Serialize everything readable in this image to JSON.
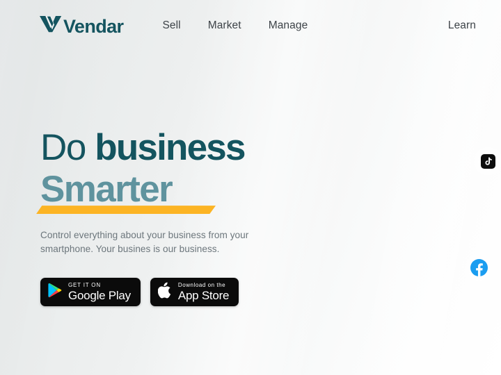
{
  "brand": {
    "name": "Vendar",
    "logo_icon": "vendar-chevron-logo-icon",
    "color": "#14545F"
  },
  "nav": {
    "items": [
      {
        "label": "Sell",
        "name": "sell"
      },
      {
        "label": "Market",
        "name": "market"
      },
      {
        "label": "Manage",
        "name": "manage"
      }
    ],
    "right_item": {
      "label": "Learn",
      "name": "learn"
    }
  },
  "hero": {
    "headline_line1_light": "Do",
    "headline_line1_bold": "business",
    "headline_line2": "Smarter",
    "subcopy": "Control everything about your business from your smartphone. Your busines is our business.",
    "accent_underline_color": "#FCB424",
    "headline_color": "#14545F",
    "headline_accent_color": "#5F939E"
  },
  "store_badges": [
    {
      "name": "google-play",
      "top_label": "GET IT ON",
      "main_label": "Google Play",
      "icon": "google-play-icon"
    },
    {
      "name": "app-store",
      "top_label": "Download on the",
      "main_label": "App Store",
      "icon": "apple-logo-icon"
    }
  ],
  "social": [
    {
      "name": "tiktok",
      "icon": "tiktok-icon",
      "color": "#0D0D0D"
    },
    {
      "name": "facebook",
      "icon": "facebook-icon",
      "color": "#1B9DF0"
    }
  ]
}
